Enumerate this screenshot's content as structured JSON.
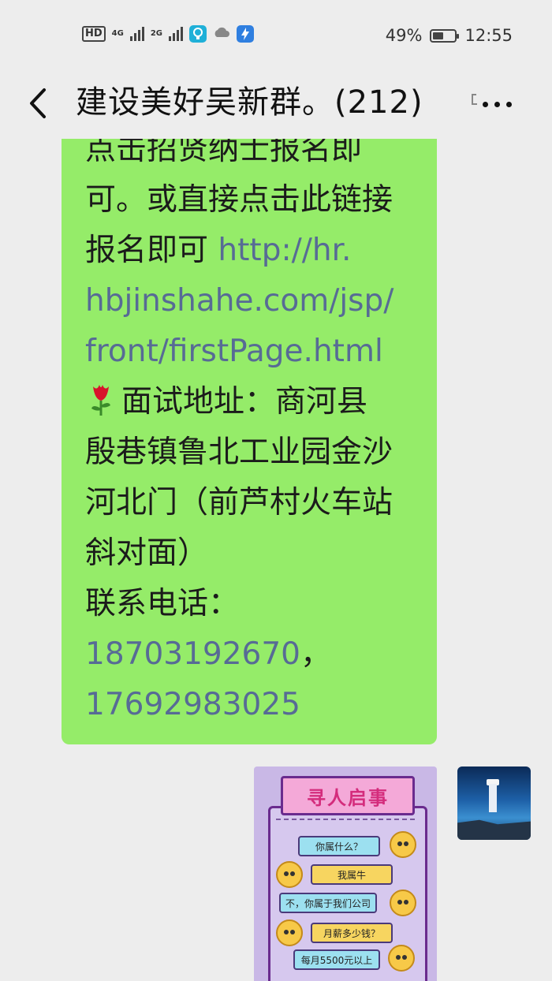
{
  "status_bar": {
    "hd": "HD",
    "network_1": "4G",
    "network_2": "2G",
    "battery_percent": "49%",
    "battery_level": 0.49,
    "time": "12:55",
    "icons": [
      "hd-icon",
      "signal-4g-icon",
      "signal-2g-icon",
      "bulb-app-icon",
      "cloud-icon",
      "flash-app-icon",
      "leaf-battery-icon"
    ]
  },
  "header": {
    "title": "建设美好吴新群。(212)",
    "back_icon": "chevron-left-icon",
    "mute_icon": "mute-icon",
    "more_icon": "more-dots-icon"
  },
  "message": {
    "lines": [
      "点击招贤纳士报名即",
      "可。或直接点击此链接",
      "报名即可 "
    ],
    "link_part1": "http://hr.",
    "link_part2": "hbjinshahe.com/jsp/",
    "link_part3": "front/firstPage.html",
    "address_label": "面试地址：商河县",
    "address_lines": [
      "殷巷镇鲁北工业园金沙",
      "河北门（前芦村火车站",
      "斜对面）"
    ],
    "phone_label": "联系电话：",
    "phone_1": "18703192670",
    "phone_sep": "，",
    "phone_2": "17692983025",
    "bubble_color": "#95ec69",
    "link_color": "#576b95"
  },
  "image_message": {
    "heading": "寻人启事",
    "dialog": [
      "你属什么？",
      "我属牛",
      "不，你属于我们公司",
      "月薪多少钱？",
      "每月5500元以上"
    ]
  }
}
